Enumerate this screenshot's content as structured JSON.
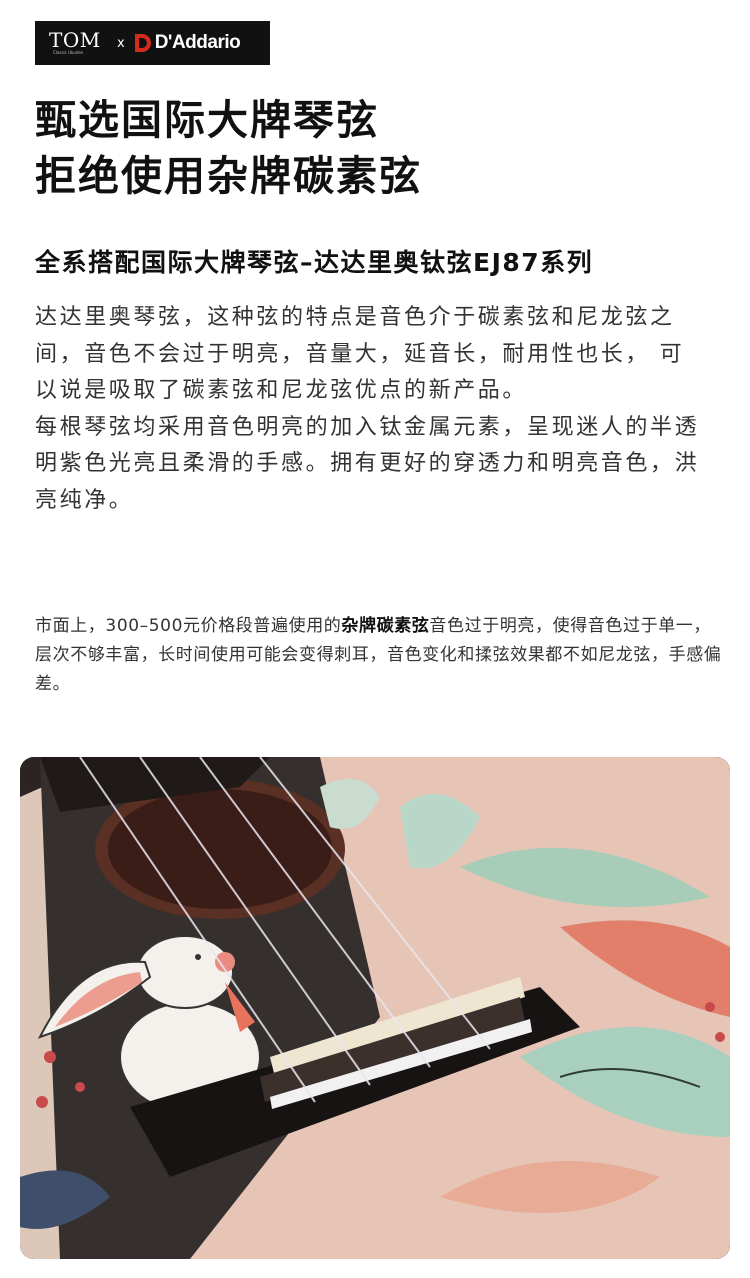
{
  "brand": {
    "tom_logo": "TOM",
    "tom_sub": "Classic Ukulele",
    "x_mark": "x",
    "daddario_logo": "D'Addario"
  },
  "headline": {
    "line1": "甄选国际大牌琴弦",
    "line2": "拒绝使用杂牌碳素弦"
  },
  "subheading": "全系搭配国际大牌琴弦–达达里奥钛弦EJ87系列",
  "description": {
    "para1": "达达里奥琴弦，这种弦的特点是音色介于碳素弦和尼龙弦之间，音色不会过于明亮，音量大，延音长，耐用性也长，  可以说是吸取了碳素弦和尼龙弦优点的新产品。",
    "para2": "每根琴弦均采用音色明亮的加入钛金属元素，呈现迷人的半透明紫色光亮且柔滑的手感。拥有更好的穿透力和明亮音色，洪亮纯净。"
  },
  "note": {
    "prefix": "市面上，300–500元价格段普遍使用的",
    "bold": "杂牌碳素弦",
    "suffix": "音色过于明亮，使得音色过于单一，层次不够丰富，长时间使用可能会变得刺耳，音色变化和揉弦效果都不如尼龙弦，手感偏差。"
  },
  "colors": {
    "badge_bg": "#111111",
    "daddario_red": "#d52b1e",
    "body_pink": "#e8c9bd",
    "leaf_green": "#9fc8b4",
    "wood_dark": "#2b2422"
  }
}
